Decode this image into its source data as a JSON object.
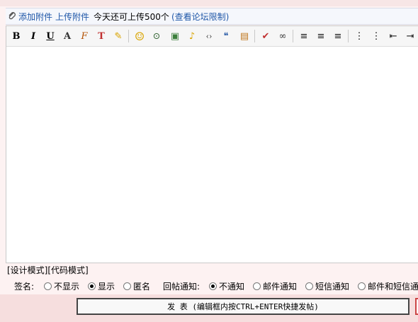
{
  "attach": {
    "add": "添加附件",
    "upload": "上传附件",
    "quota": "今天还可上传500个",
    "limit": "(查看论坛限制)"
  },
  "toolbar": {
    "bold": "B",
    "italic": "I",
    "underline": "U",
    "font_size": "A",
    "font_face": "F",
    "text_color": "T",
    "highlight": "✎",
    "smiley": "☺",
    "link": "⊙",
    "image": "▣",
    "media": "♪",
    "code": "‹›",
    "quote": "❝",
    "table": "▤",
    "clear": "✔",
    "unlink": "∞",
    "align_left": "≡",
    "align_center": "≡",
    "align_right": "≡",
    "ordered_list": "⋮",
    "unordered_list": "⋮",
    "outdent": "⇤",
    "indent": "⇥"
  },
  "modes": {
    "design": "[设计模式]",
    "code": "[代码模式]"
  },
  "signature": {
    "label": "签名:",
    "hide": "不显示",
    "show": "显示",
    "anon": "匿名",
    "selected": "显示"
  },
  "notify": {
    "label": "回帖通知:",
    "none": "不通知",
    "email": "邮件通知",
    "sms": "短信通知",
    "both": "邮件和短信通",
    "selected": "不通知"
  },
  "submit": {
    "label": "发 表 (编辑框内按CTRL+ENTER快捷发帖)"
  }
}
